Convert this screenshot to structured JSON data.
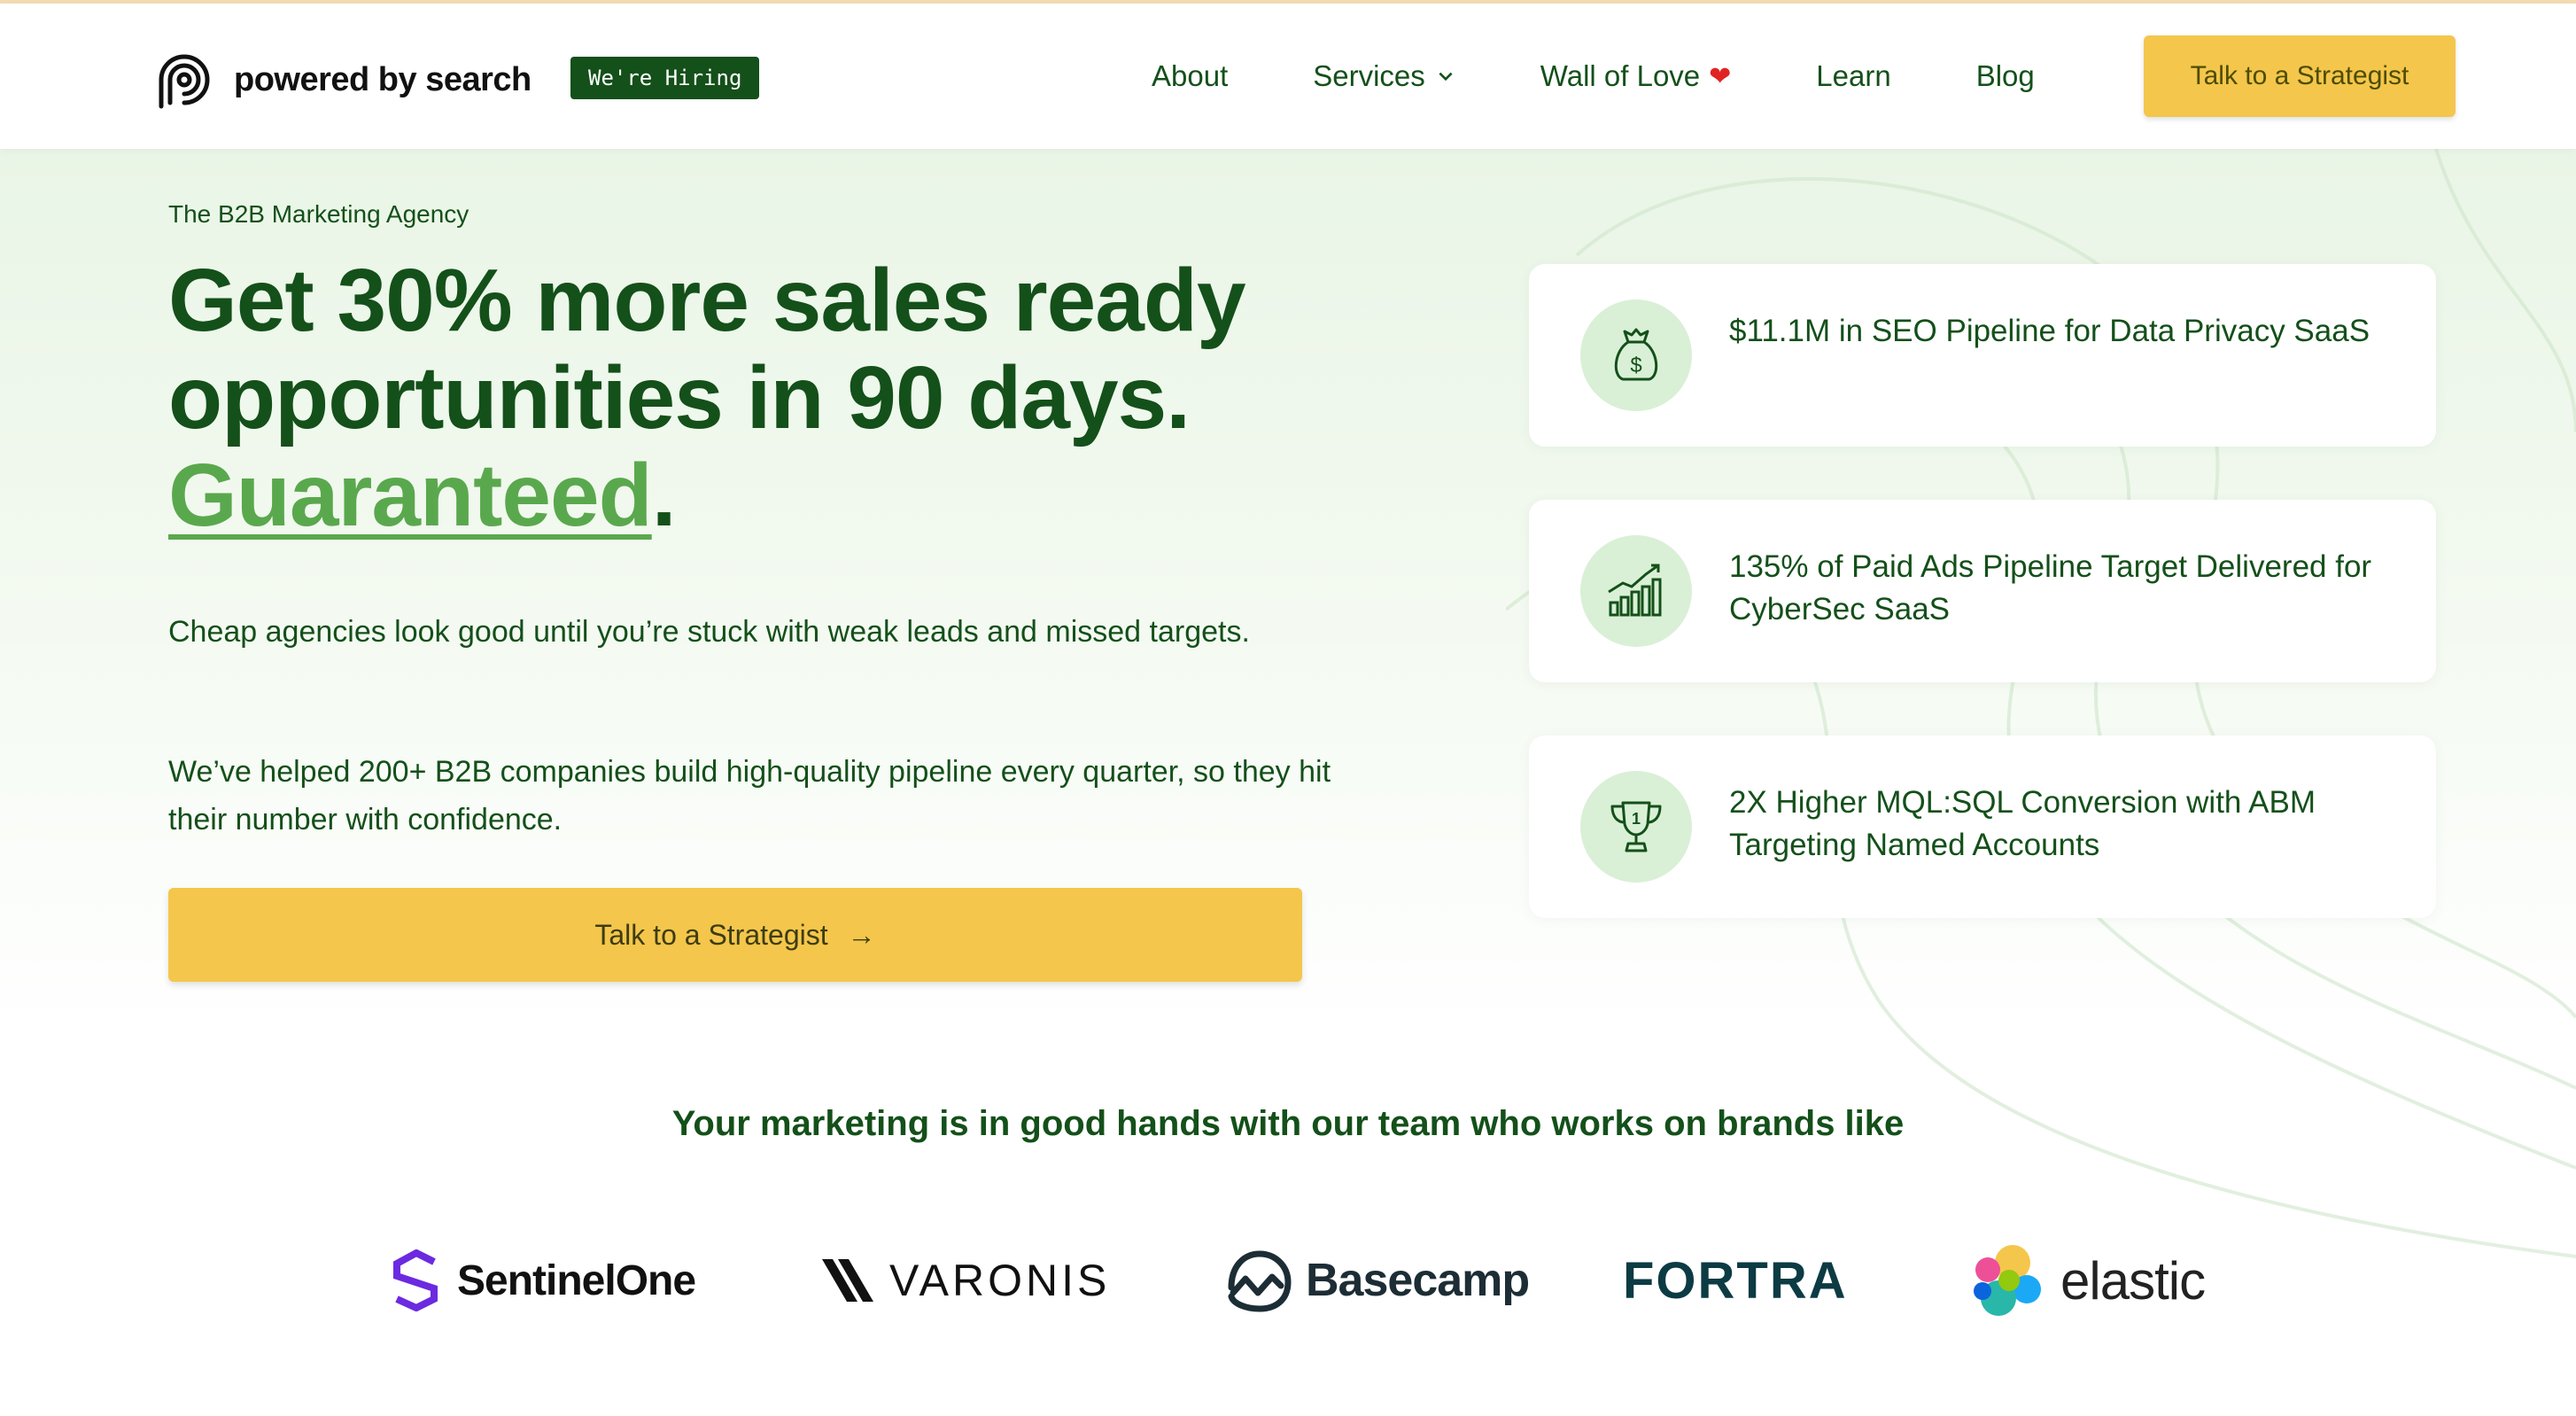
{
  "header": {
    "logo_text": "powered by search",
    "hiring_badge": "We're Hiring",
    "nav": [
      {
        "label": "About"
      },
      {
        "label": "Services"
      },
      {
        "label": "Wall of Love"
      },
      {
        "label": "Learn"
      },
      {
        "label": "Blog"
      }
    ],
    "cta": "Talk to a Strategist"
  },
  "hero": {
    "eyebrow": "The B2B Marketing Agency",
    "headline_line1": "Get 30% more sales ready",
    "headline_line2": "opportunities in 90 days.",
    "headline_accent": "Guaranteed",
    "headline_period": ".",
    "paragraph1": "Cheap agencies look good until you’re stuck with weak leads and missed targets.",
    "paragraph2": "We’ve helped 200+ B2B companies build high-quality pipeline every quarter, so they hit their number with confidence.",
    "cta": "Talk to a Strategist",
    "cta_arrow": "→"
  },
  "results": [
    {
      "icon": "money-bag-icon",
      "text": "$11.1M in SEO Pipeline for Data Privacy SaaS"
    },
    {
      "icon": "growth-chart-icon",
      "text": "135% of Paid Ads Pipeline Target Delivered for CyberSec SaaS"
    },
    {
      "icon": "trophy-icon",
      "text": "2X Higher MQL:SQL Conversion with ABM Targeting Named Accounts"
    }
  ],
  "brands": {
    "title": "Your marketing is in good hands with our team who works on brands like",
    "logos": [
      "SentinelOne",
      "VARONIS",
      "Basecamp",
      "FORTRA",
      "elastic"
    ]
  },
  "colors": {
    "brand_green": "#14501a",
    "accent_green": "#5aa84d",
    "cta_yellow": "#f4c64c",
    "icon_circle": "#d9f0d6"
  }
}
